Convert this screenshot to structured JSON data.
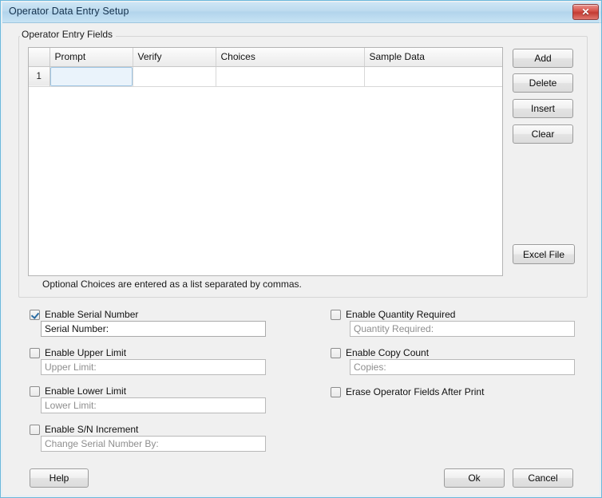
{
  "window": {
    "title": "Operator Data Entry Setup",
    "close_icon": "close-icon",
    "close_glyph": "✕",
    "accent_border": "#6ab8dd",
    "titlebar_color": "#bddbef"
  },
  "group": {
    "title": "Operator Entry Fields",
    "hint": "Optional Choices are entered as a list separated by commas."
  },
  "grid": {
    "columns": [
      "",
      "Prompt",
      "Verify",
      "Choices",
      "Sample Data"
    ],
    "rows": [
      {
        "number": "1",
        "prompt": "",
        "verify": "",
        "choices": "",
        "sample_data": ""
      }
    ],
    "selected_cell": {
      "row": 1,
      "column": "Prompt"
    }
  },
  "side_buttons": [
    {
      "id": "add",
      "label": "Add"
    },
    {
      "id": "delete",
      "label": "Delete"
    },
    {
      "id": "insert",
      "label": "Insert"
    },
    {
      "id": "clear",
      "label": "Clear"
    }
  ],
  "excel_button": {
    "label": "Excel File"
  },
  "options_left": [
    {
      "checkbox_label": "Enable Serial Number",
      "checked": true,
      "field_value": "Serial Number:",
      "field_disabled": false
    },
    {
      "checkbox_label": "Enable Upper Limit",
      "checked": false,
      "field_value": "Upper Limit:",
      "field_disabled": true
    },
    {
      "checkbox_label": "Enable Lower Limit",
      "checked": false,
      "field_value": "Lower Limit:",
      "field_disabled": true
    },
    {
      "checkbox_label": "Enable S/N Increment",
      "checked": false,
      "field_value": "Change Serial Number By:",
      "field_disabled": true
    }
  ],
  "options_right": [
    {
      "checkbox_label": "Enable Quantity Required",
      "checked": false,
      "field_value": "Quantity Required:",
      "field_disabled": true
    },
    {
      "checkbox_label": "Enable Copy Count",
      "checked": false,
      "field_value": "Copies:",
      "field_disabled": true
    },
    {
      "checkbox_label": "Erase Operator Fields After Print",
      "checked": false,
      "has_field": false
    }
  ],
  "footer": {
    "help_label": "Help",
    "ok_label": "Ok",
    "cancel_label": "Cancel"
  }
}
